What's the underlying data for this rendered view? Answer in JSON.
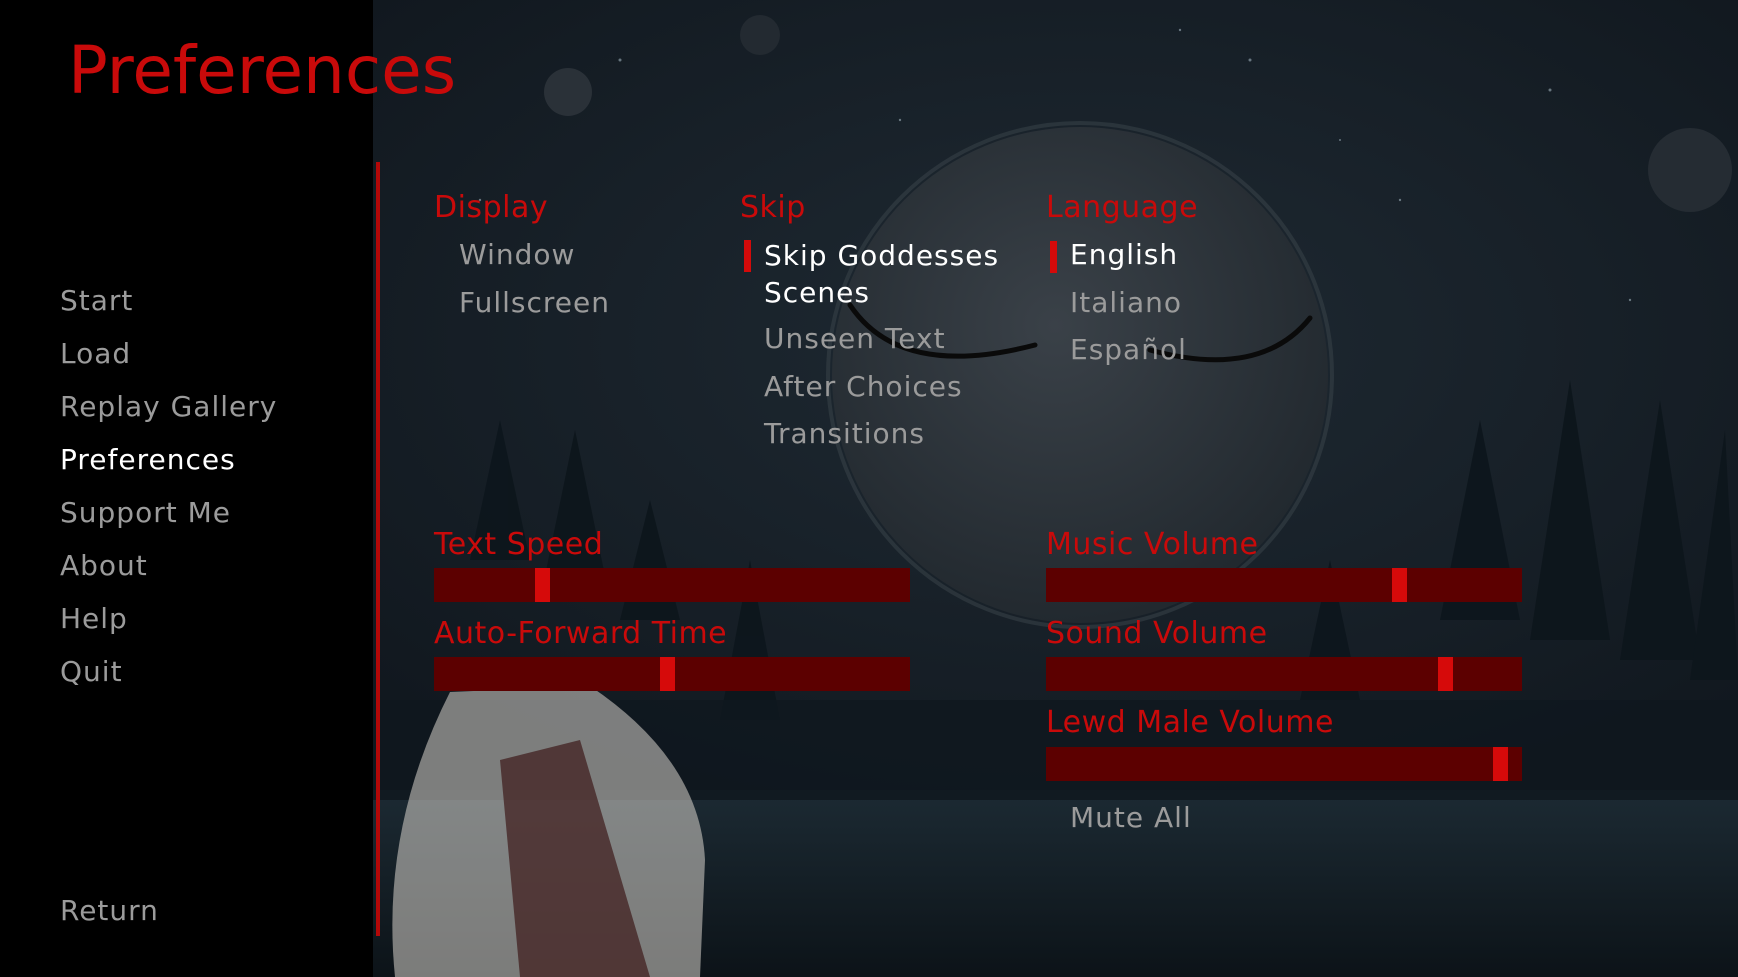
{
  "screen_title": "Preferences",
  "nav": [
    {
      "label": "Start",
      "selected": false
    },
    {
      "label": "Load",
      "selected": false
    },
    {
      "label": "Replay Gallery",
      "selected": false
    },
    {
      "label": "Preferences",
      "selected": true
    },
    {
      "label": "Support Me",
      "selected": false
    },
    {
      "label": "About",
      "selected": false
    },
    {
      "label": "Help",
      "selected": false
    },
    {
      "label": "Quit",
      "selected": false
    }
  ],
  "return_label": "Return",
  "display": {
    "header": "Display",
    "options": [
      {
        "label": "Window",
        "selected": false
      },
      {
        "label": "Fullscreen",
        "selected": false
      }
    ]
  },
  "skip": {
    "header": "Skip",
    "options": [
      {
        "label": "Skip Goddesses Scenes",
        "selected": true
      },
      {
        "label": "Unseen Text",
        "selected": false
      },
      {
        "label": "After Choices",
        "selected": false
      },
      {
        "label": "Transitions",
        "selected": false
      }
    ]
  },
  "language": {
    "header": "Language",
    "options": [
      {
        "label": "English",
        "selected": true
      },
      {
        "label": "Italiano",
        "selected": false
      },
      {
        "label": "Español",
        "selected": false
      }
    ]
  },
  "sliders": {
    "text_speed": {
      "label": "Text Speed",
      "value": 0.22
    },
    "auto_forward": {
      "label": "Auto-Forward Time",
      "value": 0.49
    },
    "music_volume": {
      "label": "Music Volume",
      "value": 0.75
    },
    "sound_volume": {
      "label": "Sound Volume",
      "value": 0.85
    },
    "lewd_male_volume": {
      "label": "Lewd Male Volume",
      "value": 0.97
    }
  },
  "mute_all": "Mute All",
  "colors": {
    "accent": "#c90a0a",
    "slider_track": "#5c0000",
    "slider_thumb": "#d60a0a",
    "text_idle": "#9b9b9b",
    "text_selected": "#ffffff",
    "panel": "#000000"
  }
}
